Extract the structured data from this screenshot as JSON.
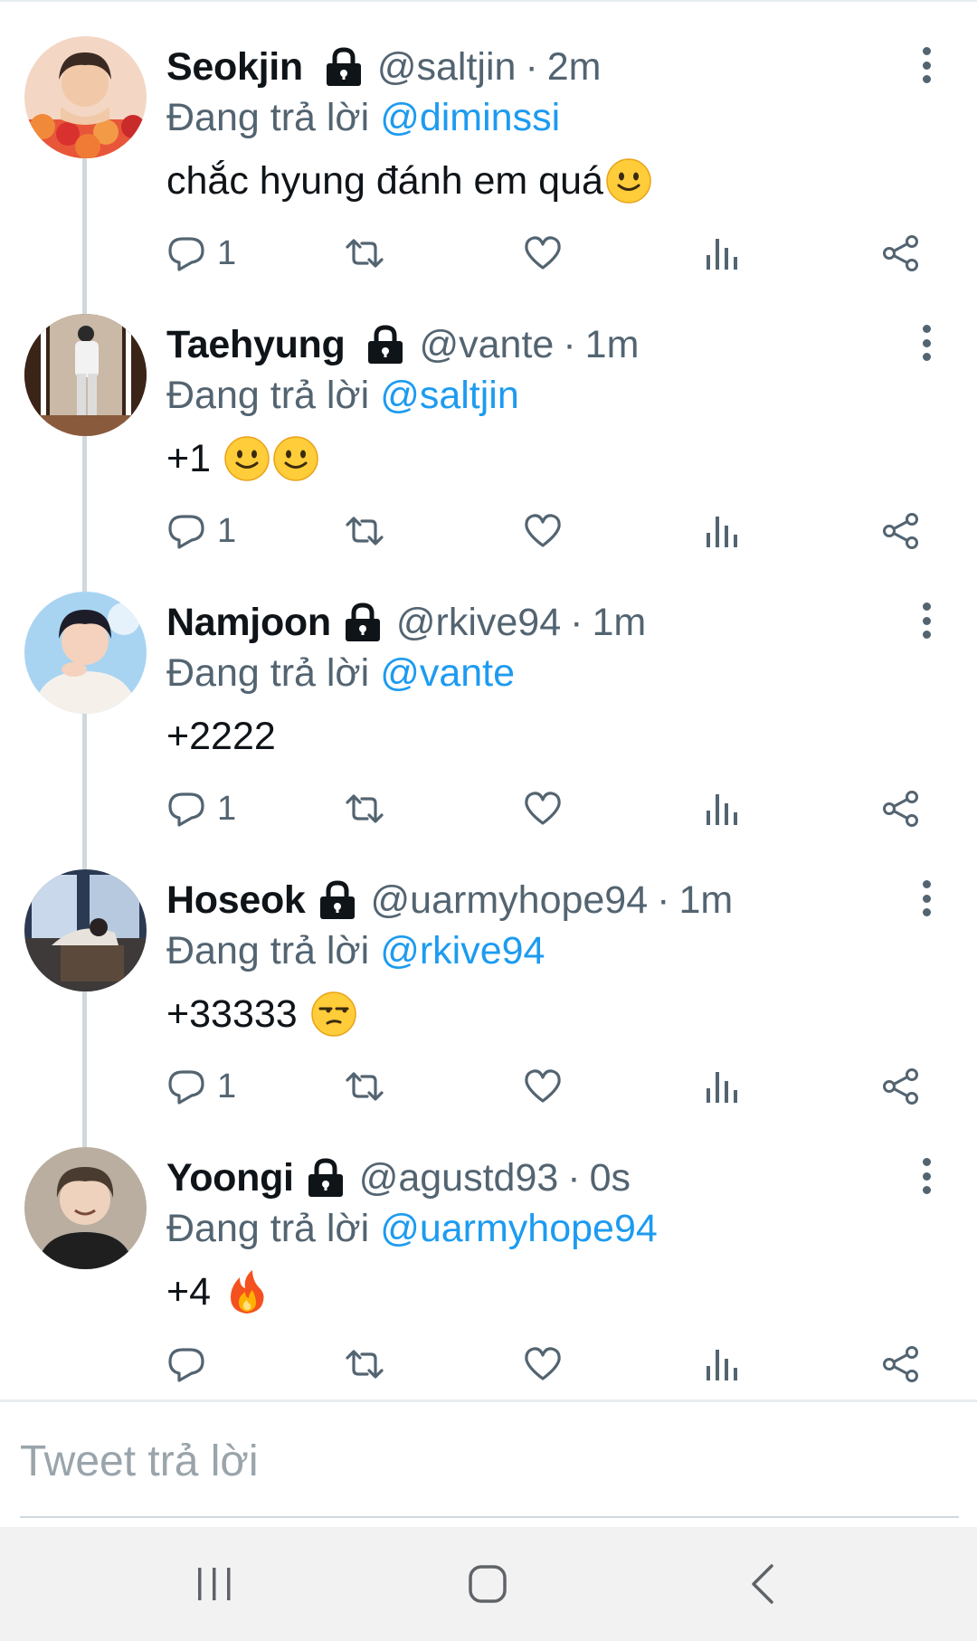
{
  "reply_prefix": "Đang trả lời",
  "tweets": [
    {
      "name": "Seokjin",
      "handle": "@saltjin",
      "separator": "·",
      "time": "2m",
      "reply_to": "@diminssi",
      "text": "chắc hyung đánh em quá",
      "emojis": [
        "slightly-smiling-face"
      ],
      "reply_count": "1",
      "avatar": "avatar-seokjin"
    },
    {
      "name": "Taehyung",
      "handle": "@vante",
      "separator": "·",
      "time": "1m",
      "reply_to": "@saltjin",
      "text": "+1 ",
      "emojis": [
        "slightly-smiling-face",
        "slightly-smiling-face"
      ],
      "reply_count": "1",
      "avatar": "avatar-taehyung"
    },
    {
      "name": "Namjoon",
      "handle": "@rkive94",
      "separator": "·",
      "time": "1m",
      "reply_to": "@vante",
      "text": "+2222",
      "emojis": [],
      "reply_count": "1",
      "avatar": "avatar-namjoon"
    },
    {
      "name": "Hoseok",
      "handle": "@uarmyhope94",
      "separator": "·",
      "time": "1m",
      "reply_to": "@rkive94",
      "text": "+33333 ",
      "emojis": [
        "unamused-face"
      ],
      "reply_count": "1",
      "avatar": "avatar-hoseok"
    },
    {
      "name": "Yoongi",
      "handle": "@agustd93",
      "separator": "·",
      "time": "0s",
      "reply_to": "@uarmyhope94",
      "text": "+4 ",
      "emojis": [
        "fire"
      ],
      "reply_count": "",
      "avatar": "avatar-yoongi"
    }
  ],
  "composer": {
    "placeholder": "Tweet trả lời"
  },
  "icons": {
    "reply": "reply-icon",
    "retweet": "retweet-icon",
    "like": "heart-icon",
    "views": "analytics-icon",
    "share": "share-icon",
    "protected": "lock-icon",
    "more": "more-vertical-icon"
  },
  "colors": {
    "link": "#1d9bf0",
    "secondary_text": "#536471",
    "thread_line": "#cfd9de",
    "navbar_bg": "#f2f2f2"
  }
}
